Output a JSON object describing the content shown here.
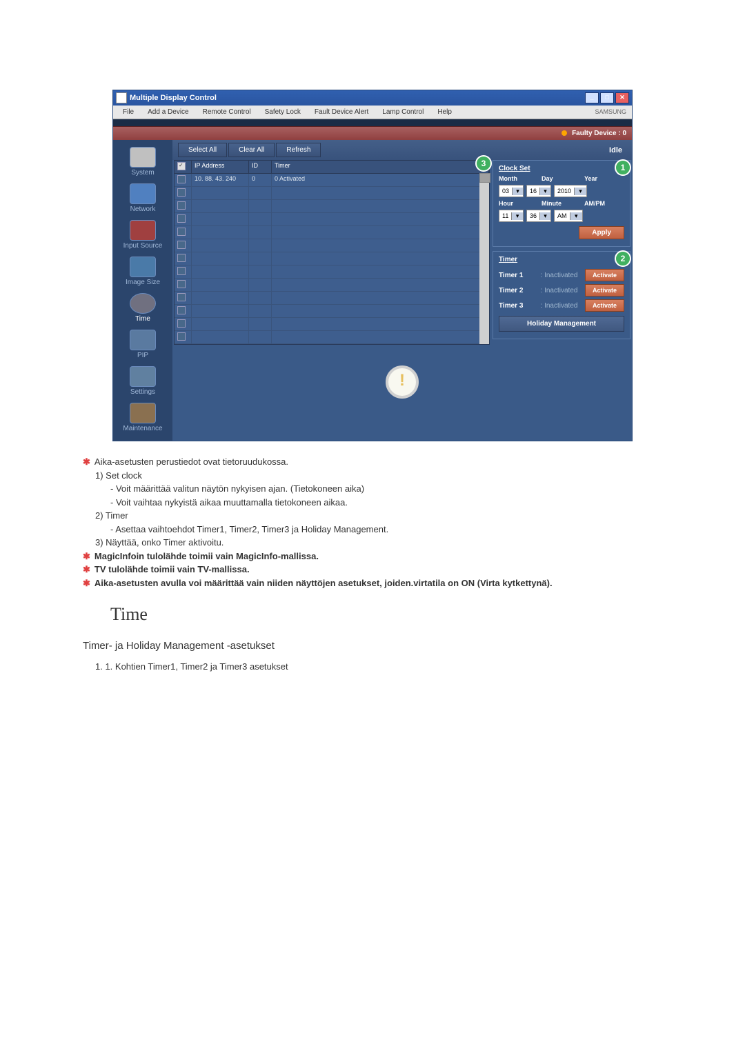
{
  "window": {
    "title": "Multiple Display Control",
    "brand": "SAMSUNG"
  },
  "menu": {
    "file": "File",
    "add": "Add a Device",
    "remote": "Remote Control",
    "safety": "Safety Lock",
    "fault": "Fault Device Alert",
    "lamp": "Lamp Control",
    "help": "Help"
  },
  "status_strip": "Faulty Device : 0",
  "sidebar": {
    "system": "System",
    "network": "Network",
    "input": "Input Source",
    "image": "Image Size",
    "time": "Time",
    "pip": "PIP",
    "settings": "Settings",
    "maintenance": "Maintenance"
  },
  "topbuttons": {
    "selectall": "Select All",
    "clearall": "Clear All",
    "refresh": "Refresh",
    "idle": "Idle"
  },
  "table": {
    "th_ip": "IP Address",
    "th_id": "ID",
    "th_timer": "Timer",
    "row_ip": "10. 88. 43. 240",
    "row_id": "0",
    "row_timer": "0 Activated"
  },
  "clock": {
    "title": "Clock Set",
    "l_month": "Month",
    "l_day": "Day",
    "l_year": "Year",
    "v_month": "03",
    "v_day": "16",
    "v_year": "2010",
    "l_hour": "Hour",
    "l_min": "Minute",
    "l_ampm": "AM/PM",
    "v_hour": "11",
    "v_min": "36",
    "v_ampm": "AM",
    "apply": "Apply"
  },
  "timer": {
    "title": "Timer",
    "t1": "Timer 1",
    "t2": "Timer 2",
    "t3": "Timer 3",
    "status": ": Inactivated",
    "activate": "Activate",
    "holiday": "Holiday Management"
  },
  "callouts": {
    "c1": "1",
    "c2": "2",
    "c3": "3"
  },
  "doc": {
    "b1": "Aika-asetusten perustiedot ovat tietoruudukossa.",
    "l1": "1)  Set clock",
    "l1a": "-  Voit määrittää valitun näytön nykyisen ajan. (Tietokoneen aika)",
    "l1b": "-  Voit vaihtaa nykyistä aikaa muuttamalla tietokoneen aikaa.",
    "l2": "2)  Timer",
    "l2a": "-  Asettaa vaihtoehdot Timer1, Timer2, Timer3 ja Holiday Management.",
    "l3": "3)  Näyttää, onko Timer aktivoitu.",
    "b2": "MagicInfoin tulolähde toimii vain MagicInfo-mallissa.",
    "b3": "TV tulolähde toimii vain TV-mallissa.",
    "b4": "Aika-asetusten avulla voi määrittää vain niiden näyttöjen asetukset, joiden.virtatila on ON (Virta kytkettynä).",
    "h1": "Time",
    "h2": "Timer- ja Holiday Management -asetukset",
    "l4": "1.  1. Kohtien Timer1, Timer2 ja Timer3 asetukset"
  }
}
